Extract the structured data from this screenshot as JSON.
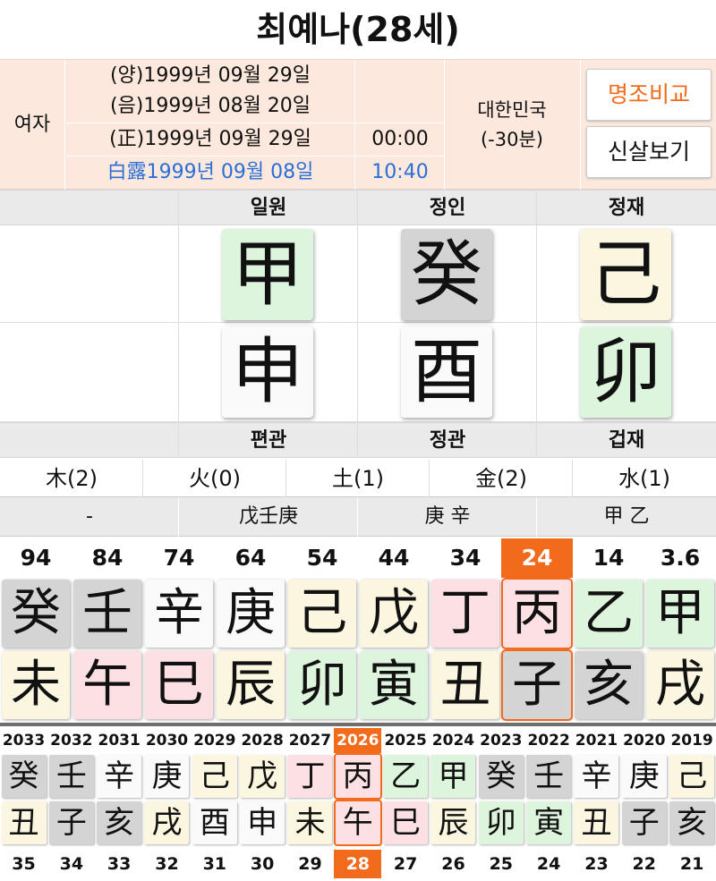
{
  "header": {
    "title": "최예나(28세)"
  },
  "info": {
    "gender": "여자",
    "solar": "(양)1999년 09월 29일",
    "lunar": "(음)1999년 08월 20일",
    "correct": "(正)1999년 09월 29일",
    "correct_time": "00:00",
    "term": "白露1999년 09월 08일",
    "term_time": "10:40",
    "country": "대한민국",
    "offset": "(-30분)",
    "btn_compare": "명조비교",
    "btn_sinsal": "신살보기"
  },
  "top_labels": [
    "",
    "일원",
    "정인",
    "정재"
  ],
  "stems": [
    {
      "char": "",
      "color": "none"
    },
    {
      "char": "甲",
      "color": "green"
    },
    {
      "char": "癸",
      "color": "gray"
    },
    {
      "char": "己",
      "color": "yellow"
    }
  ],
  "branches": [
    {
      "char": "",
      "color": "none"
    },
    {
      "char": "申",
      "color": "white"
    },
    {
      "char": "酉",
      "color": "white"
    },
    {
      "char": "卯",
      "color": "green"
    }
  ],
  "bottom_labels": [
    "",
    "편관",
    "정관",
    "겁재"
  ],
  "ohaeng": [
    "木(2)",
    "火(0)",
    "土(1)",
    "金(2)",
    "水(1)"
  ],
  "jijanggan": [
    "-",
    "戊壬庚",
    "庚 辛",
    "甲 乙"
  ],
  "daeun": [
    {
      "age": "94",
      "stem": "癸",
      "sc": "gray",
      "branch": "未",
      "bc": "yellow"
    },
    {
      "age": "84",
      "stem": "壬",
      "sc": "gray",
      "branch": "午",
      "bc": "pink"
    },
    {
      "age": "74",
      "stem": "辛",
      "sc": "white",
      "branch": "巳",
      "bc": "pink"
    },
    {
      "age": "64",
      "stem": "庚",
      "sc": "white",
      "branch": "辰",
      "bc": "yellow"
    },
    {
      "age": "54",
      "stem": "己",
      "sc": "yellow",
      "branch": "卯",
      "bc": "green"
    },
    {
      "age": "44",
      "stem": "戊",
      "sc": "yellow",
      "branch": "寅",
      "bc": "green"
    },
    {
      "age": "34",
      "stem": "丁",
      "sc": "pink",
      "branch": "丑",
      "bc": "yellow"
    },
    {
      "age": "24",
      "stem": "丙",
      "sc": "pink",
      "branch": "子",
      "bc": "gray",
      "current": true
    },
    {
      "age": "14",
      "stem": "乙",
      "sc": "green",
      "branch": "亥",
      "bc": "gray"
    },
    {
      "age": "3.6",
      "stem": "甲",
      "sc": "green",
      "branch": "戌",
      "bc": "yellow"
    }
  ],
  "seun": [
    {
      "year": "2033",
      "stem": "癸",
      "sc": "gray",
      "branch": "丑",
      "bc": "yellow",
      "age": "35"
    },
    {
      "year": "2032",
      "stem": "壬",
      "sc": "gray",
      "branch": "子",
      "bc": "gray",
      "age": "34"
    },
    {
      "year": "2031",
      "stem": "辛",
      "sc": "white",
      "branch": "亥",
      "bc": "gray",
      "age": "33"
    },
    {
      "year": "2030",
      "stem": "庚",
      "sc": "white",
      "branch": "戌",
      "bc": "yellow",
      "age": "32"
    },
    {
      "year": "2029",
      "stem": "己",
      "sc": "yellow",
      "branch": "酉",
      "bc": "white",
      "age": "31"
    },
    {
      "year": "2028",
      "stem": "戊",
      "sc": "yellow",
      "branch": "申",
      "bc": "white",
      "age": "30"
    },
    {
      "year": "2027",
      "stem": "丁",
      "sc": "pink",
      "branch": "未",
      "bc": "yellow",
      "age": "29"
    },
    {
      "year": "2026",
      "stem": "丙",
      "sc": "pink",
      "branch": "午",
      "bc": "pink",
      "age": "28",
      "current": true
    },
    {
      "year": "2025",
      "stem": "乙",
      "sc": "green",
      "branch": "巳",
      "bc": "pink",
      "age": "27"
    },
    {
      "year": "2024",
      "stem": "甲",
      "sc": "green",
      "branch": "辰",
      "bc": "yellow",
      "age": "26"
    },
    {
      "year": "2023",
      "stem": "癸",
      "sc": "gray",
      "branch": "卯",
      "bc": "green",
      "age": "25"
    },
    {
      "year": "2022",
      "stem": "壬",
      "sc": "gray",
      "branch": "寅",
      "bc": "green",
      "age": "24"
    },
    {
      "year": "2021",
      "stem": "辛",
      "sc": "white",
      "branch": "丑",
      "bc": "yellow",
      "age": "23"
    },
    {
      "year": "2020",
      "stem": "庚",
      "sc": "white",
      "branch": "子",
      "bc": "gray",
      "age": "22"
    },
    {
      "year": "2019",
      "stem": "己",
      "sc": "yellow",
      "branch": "亥",
      "bc": "gray",
      "age": "21"
    }
  ],
  "colors": {
    "accent": "#f26a1b",
    "blue": "#2a6fd6",
    "info_bg": "#fce8dc"
  }
}
